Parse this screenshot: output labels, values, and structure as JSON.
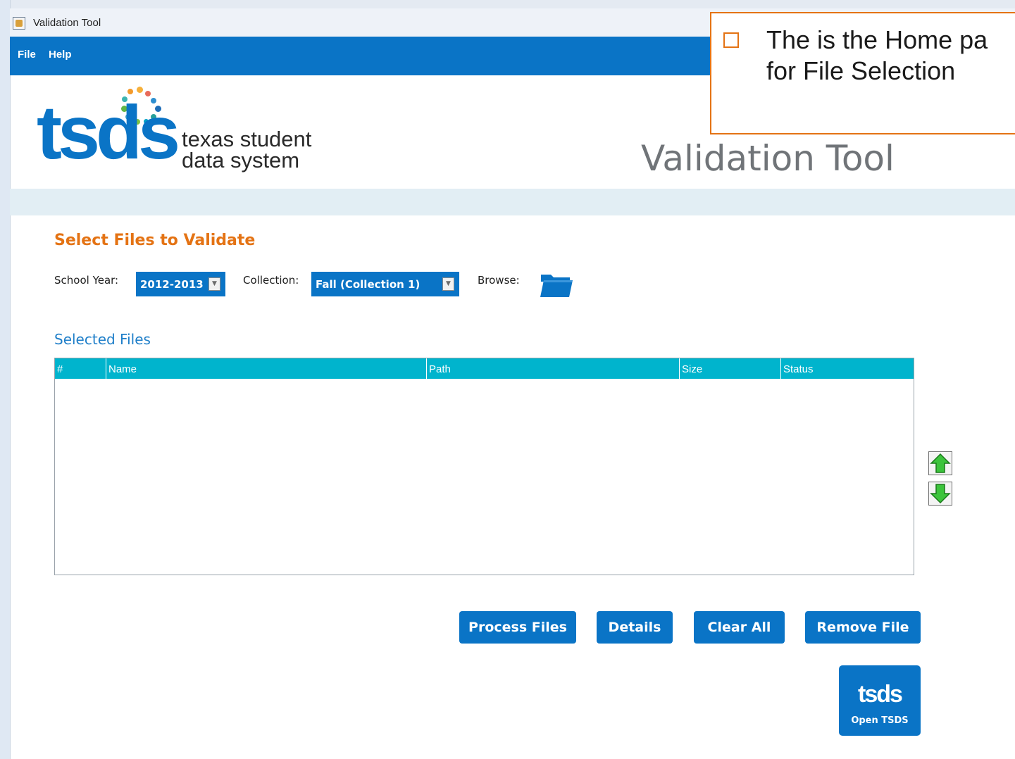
{
  "window": {
    "title": "Validation Tool",
    "icon": "java-app-icon"
  },
  "menu": {
    "items": [
      "File",
      "Help"
    ]
  },
  "branding": {
    "logo_word": "tsds",
    "tagline_line1": "texas student",
    "tagline_line2": "data system",
    "app_heading": "Validation Tool"
  },
  "selection": {
    "title": "Select Files to Validate",
    "school_year_label": "School Year:",
    "school_year_value": "2012-2013",
    "collection_label": "Collection:",
    "collection_value": "Fall (Collection 1)",
    "browse_label": "Browse:",
    "browse_icon": "folder-icon"
  },
  "files": {
    "title": "Selected Files",
    "columns": [
      "#",
      "Name",
      "Path",
      "Size",
      "Status"
    ],
    "rows": []
  },
  "reorder": {
    "up_icon": "arrow-up-icon",
    "down_icon": "arrow-down-icon"
  },
  "actions": {
    "process": "Process Files",
    "details": "Details",
    "clear": "Clear All",
    "remove": "Remove File",
    "open_tsds_logo": "tsds",
    "open_tsds": "Open TSDS"
  },
  "callout": {
    "text": "The is the Home pa\nfor File Selection"
  },
  "colors": {
    "brand_blue": "#0a74c6",
    "header_teal": "#00b4cd",
    "accent_orange": "#e47314"
  }
}
